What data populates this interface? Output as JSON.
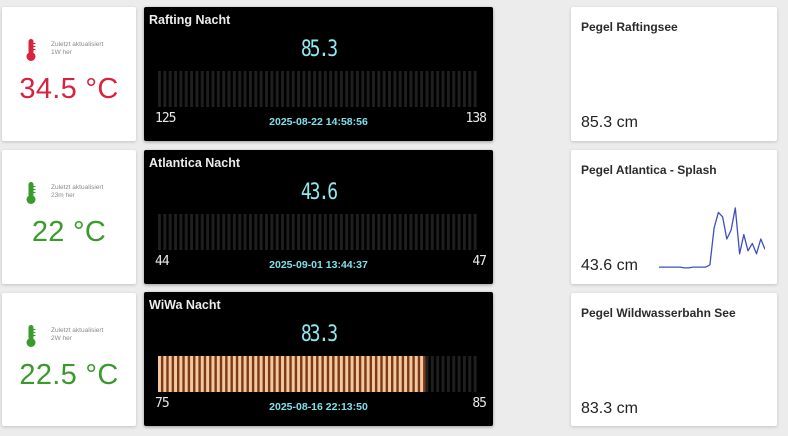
{
  "colors": {
    "hot": "#d6233f",
    "ok": "#3a9a2c",
    "bar_idle": "#1f1f1f",
    "bar_fill": "#f4c7a3",
    "spark_line": "#3e4fbf",
    "value_cyan": "#8fe8f2"
  },
  "icons": {
    "thermometer": "thermometer-icon"
  },
  "temperatures": [
    {
      "updated_label": "Zuletzt aktualisiert",
      "updated_ago": "1W her",
      "value": "34.5 °C",
      "status": "hot"
    },
    {
      "updated_label": "Zuletzt aktualisiert",
      "updated_ago": "23m her",
      "value": "22 °C",
      "status": "ok"
    },
    {
      "updated_label": "Zuletzt aktualisiert",
      "updated_ago": "2W her",
      "value": "22.5 °C",
      "status": "ok"
    }
  ],
  "panels": [
    {
      "title": "Rafting Nacht",
      "value": "85.3",
      "min": "125",
      "max": "138",
      "timestamp": "2025-08-22 14:58:56",
      "fill_fraction": 0
    },
    {
      "title": "Atlantica Nacht",
      "value": "43.6",
      "min": "44",
      "max": "47",
      "timestamp": "2025-09-01 13:44:37",
      "fill_fraction": 0
    },
    {
      "title": "WiWa Nacht",
      "value": "83.3",
      "min": "75",
      "max": "85",
      "timestamp": "2025-08-16 22:13:50",
      "fill_fraction": 0.83
    }
  ],
  "levels": [
    {
      "title": "Pegel Raftingsee",
      "value": "85.3 cm"
    },
    {
      "title": "Pegel Atlantica - Splash",
      "value": "43.6 cm",
      "trend": [
        0.12,
        0.12,
        0.12,
        0.12,
        0.12,
        0.12,
        0.11,
        0.11,
        0.12,
        0.12,
        0.12,
        0.12,
        0.15,
        0.65,
        0.86,
        0.8,
        0.5,
        0.62,
        0.92,
        0.3,
        0.56,
        0.34,
        0.44,
        0.3,
        0.5,
        0.36
      ]
    },
    {
      "title": "Pegel Wildwasserbahn See",
      "value": "83.3 cm"
    }
  ]
}
